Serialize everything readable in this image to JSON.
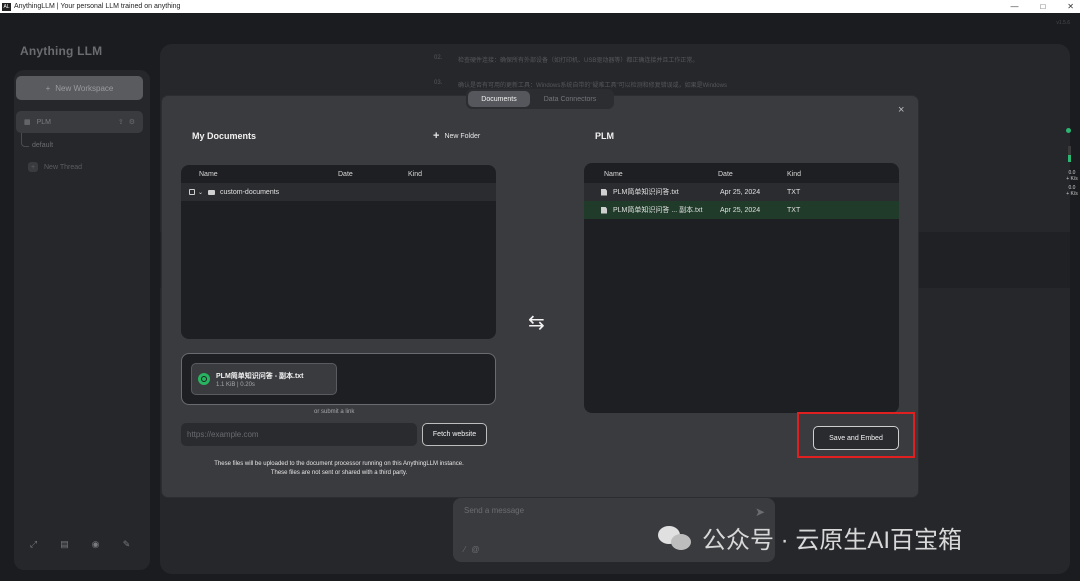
{
  "window": {
    "title": "AnythingLLM | Your personal LLM trained on anything",
    "app_icon": "AL",
    "controls": [
      "—",
      "□",
      "✕"
    ]
  },
  "sidebar": {
    "logo": "Anything LLM",
    "new_workspace": "New Workspace",
    "workspace": {
      "name": "PLM",
      "thread": "default"
    },
    "new_thread": "New Thread",
    "footer_icons": [
      "support-icon",
      "docs-icon",
      "discord-icon",
      "settings-icon"
    ]
  },
  "background": {
    "lines": [
      {
        "n": "02.",
        "text": "检查硬件连接：确保所有外部设备（如打印机、USB驱动器等）都正确连接并且工作正常。"
      },
      {
        "n": "03.",
        "text": "确认是否有可用的更新工具：Windows系统自带的\"疑难工具\"可以检测和修复错误或，如果是Windows"
      },
      {
        "n": "",
        "text": "……"
      }
    ],
    "top_right": "v1.5.6"
  },
  "message_box": {
    "placeholder": "Send a message"
  },
  "edge": {
    "val1": "0.0",
    "unit1": "+ K/s",
    "val2": "0.0",
    "unit2": "+ K/s"
  },
  "modal": {
    "tabs": {
      "documents": "Documents",
      "data_connectors": "Data Connectors"
    },
    "close": "×",
    "my_documents": {
      "title": "My Documents",
      "new_folder": "New Folder",
      "columns": {
        "name": "Name",
        "date": "Date",
        "kind": "Kind"
      },
      "rows": [
        {
          "name": "custom-documents"
        }
      ]
    },
    "upload": {
      "file_name": "PLM简单知识问答 - 副本.txt",
      "meta": "1.1 KiB | 0.20s"
    },
    "or_link": "or submit a link",
    "url_placeholder": "https://example.com",
    "fetch_button": "Fetch website",
    "notice_line1": "These files will be uploaded to the document processor running on this AnythingLLM instance.",
    "notice_line2": "These files are not sent or shared with a third party.",
    "workspace": {
      "title": "PLM",
      "columns": {
        "name": "Name",
        "date": "Date",
        "kind": "Kind"
      },
      "rows": [
        {
          "name": "PLM简单知识问答.txt",
          "date": "Apr 25, 2024",
          "kind": "TXT"
        },
        {
          "name": "PLM简单知识问答 ... 副本.txt",
          "date": "Apr 25, 2024",
          "kind": "TXT"
        }
      ]
    },
    "save_button": "Save and Embed",
    "swap": "⇆"
  },
  "watermark": {
    "text": "公众号 · 云原生AI百宝箱"
  }
}
